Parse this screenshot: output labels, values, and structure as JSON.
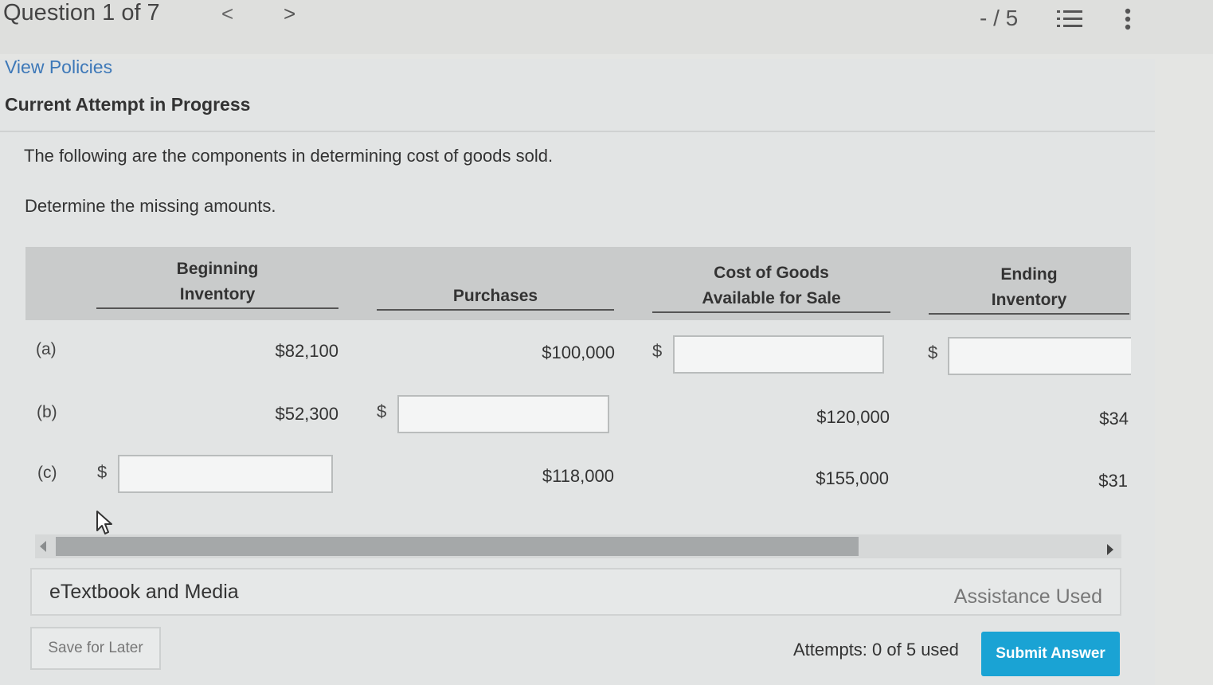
{
  "header": {
    "question_label": "Question 1 of 7",
    "prev_glyph": "<",
    "next_glyph": ">",
    "score": "- / 5",
    "icons": [
      "chevron-left-icon",
      "chevron-right-icon",
      "list-icon",
      "more-vertical-icon"
    ]
  },
  "links": {
    "view_policies": "View Policies"
  },
  "attempt_heading": "Current Attempt in Progress",
  "question": {
    "intro": "The following are the components in determining cost of goods sold.",
    "instruction": "Determine the missing amounts."
  },
  "table": {
    "headers": {
      "beginning_inventory": [
        "Beginning",
        "Inventory"
      ],
      "purchases": [
        "Purchases"
      ],
      "cogas": [
        "Cost of Goods",
        "Available for Sale"
      ],
      "ending_inventory": [
        "Ending",
        "Inventory"
      ]
    },
    "currency_symbol": "$",
    "rows": [
      {
        "label": "(a)",
        "beginning_inventory": "$82,100",
        "purchases": "$100,000",
        "cogas": "",
        "ending_inventory": ""
      },
      {
        "label": "(b)",
        "beginning_inventory": "$52,300",
        "purchases": "",
        "cogas": "$120,000",
        "ending_inventory": "$34"
      },
      {
        "label": "(c)",
        "beginning_inventory": "",
        "purchases": "$118,000",
        "cogas": "$155,000",
        "ending_inventory": "$31"
      }
    ]
  },
  "footer": {
    "etextbook": "eTextbook and Media",
    "assistance": "Assistance Used",
    "save_later": "Save for Later",
    "attempts": "Attempts: 0 of 5 used",
    "submit": "Submit Answer"
  },
  "colors": {
    "link": "#3d78b8",
    "submit_button": "#1aa3d4",
    "table_header": "#c9cbcb"
  }
}
